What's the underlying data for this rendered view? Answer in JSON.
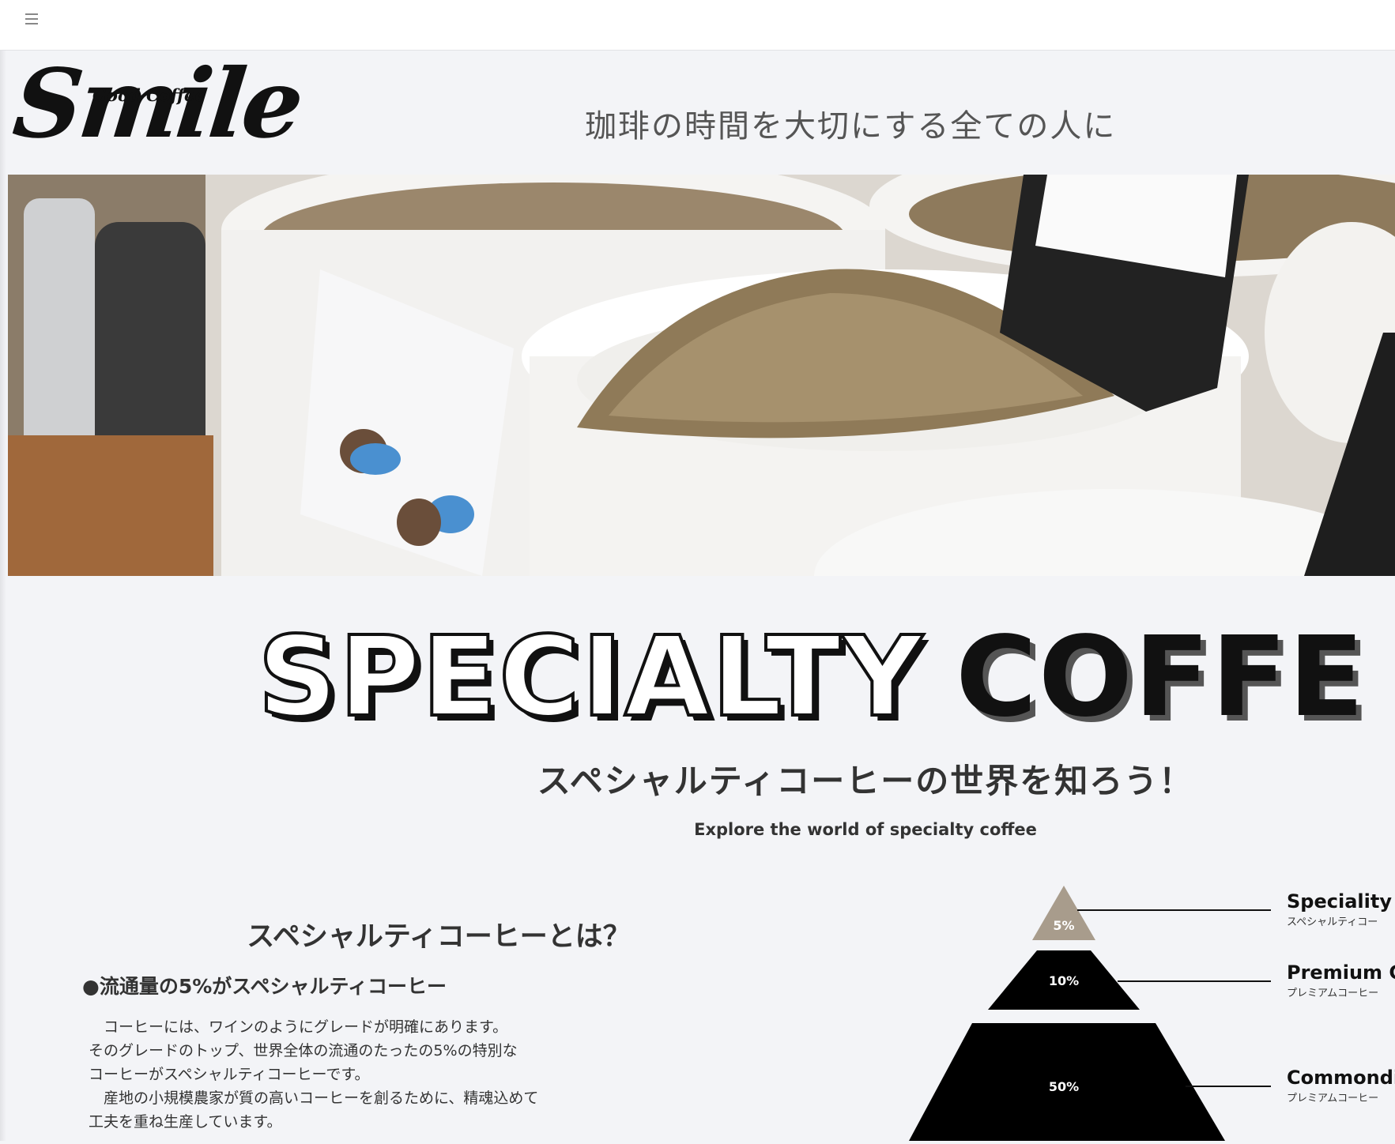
{
  "header": {
    "menu_icon": "hamburger-menu-icon"
  },
  "brand": {
    "logo_text": "Smile",
    "logo_tag": "Good Coffee",
    "tagline": "珈琲の時間を大切にする全ての人に"
  },
  "hero": {
    "image": "green-coffee-beans-in-white-buckets"
  },
  "section": {
    "title_outline": "SPECIALTY",
    "title_solid": "COFFE",
    "subtitle_jp": "スペシャルティコーヒーの世界を知ろう！",
    "subtitle_en": "Explore the world of specialty coffee"
  },
  "about": {
    "heading": "スペシャルティコーヒーとは？",
    "point_heading": "●流通量の5%がスペシャルティコーヒー",
    "body": "　コーヒーには、ワインのようにグレードが明確にあります。\nそのグレードのトップ、世界全体の流通のたったの5%の特別な\nコーヒーがスペシャルティコーヒーです。\n　産地の小規模農家が質の高いコーヒーを創るために、精魂込めて\n工夫を重ね生産しています。"
  },
  "pyramid": {
    "levels": [
      {
        "percent": "5%",
        "label_en": "Speciality",
        "label_jp": "スペシャルティコー",
        "color": "#a89c8c"
      },
      {
        "percent": "10%",
        "label_en": "Premium C",
        "label_jp": "プレミアムコーヒー",
        "color": "#000000"
      },
      {
        "percent": "50%",
        "label_en": "Commondi",
        "label_jp": "プレミアムコーヒー",
        "color": "#000000"
      }
    ]
  }
}
